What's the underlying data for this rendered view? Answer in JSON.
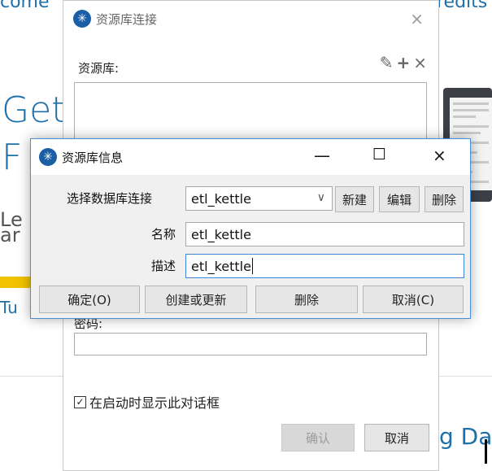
{
  "background": {
    "top_left_fragment": "come",
    "top_right_fragment": "redits",
    "heading_line1": "Get",
    "heading_line2": "F",
    "text_line1": "Le",
    "text_line2": "ar",
    "link_fragment": "Tu",
    "bottom_right_fragment": "g Dat"
  },
  "repo_dialog": {
    "title": "资源库连接",
    "close_icon": "×",
    "repository_label": "资源库:",
    "tools": {
      "edit_icon": "✎",
      "add_icon": "+",
      "remove_icon": "×"
    },
    "under_label": "密码:",
    "show_on_startup_checked": true,
    "show_on_startup_label": "在启动时显示此对话框",
    "ok_label": "确认",
    "cancel_label": "取消"
  },
  "info_dialog": {
    "title": "资源库信息",
    "minimize_icon": "—",
    "maximize_icon": "☐",
    "close_icon": "×",
    "db_connection_label": "选择数据库连接",
    "db_connection_value": "etl_kettle",
    "new_label": "新建",
    "edit_label": "编辑",
    "delete_small_label": "删除",
    "name_label": "名称",
    "name_value": "etl_kettle",
    "description_label": "描述",
    "description_value": "etl_kettle",
    "confirm_label": "确定(O)",
    "create_update_label": "创建或更新",
    "delete_label": "删除",
    "cancel_label": "取消(C)"
  },
  "colors": {
    "accent": "#3d86d8",
    "link": "#1f6fa8",
    "yellow_bar": "#f2c200",
    "logo": "#1a5fa6"
  }
}
